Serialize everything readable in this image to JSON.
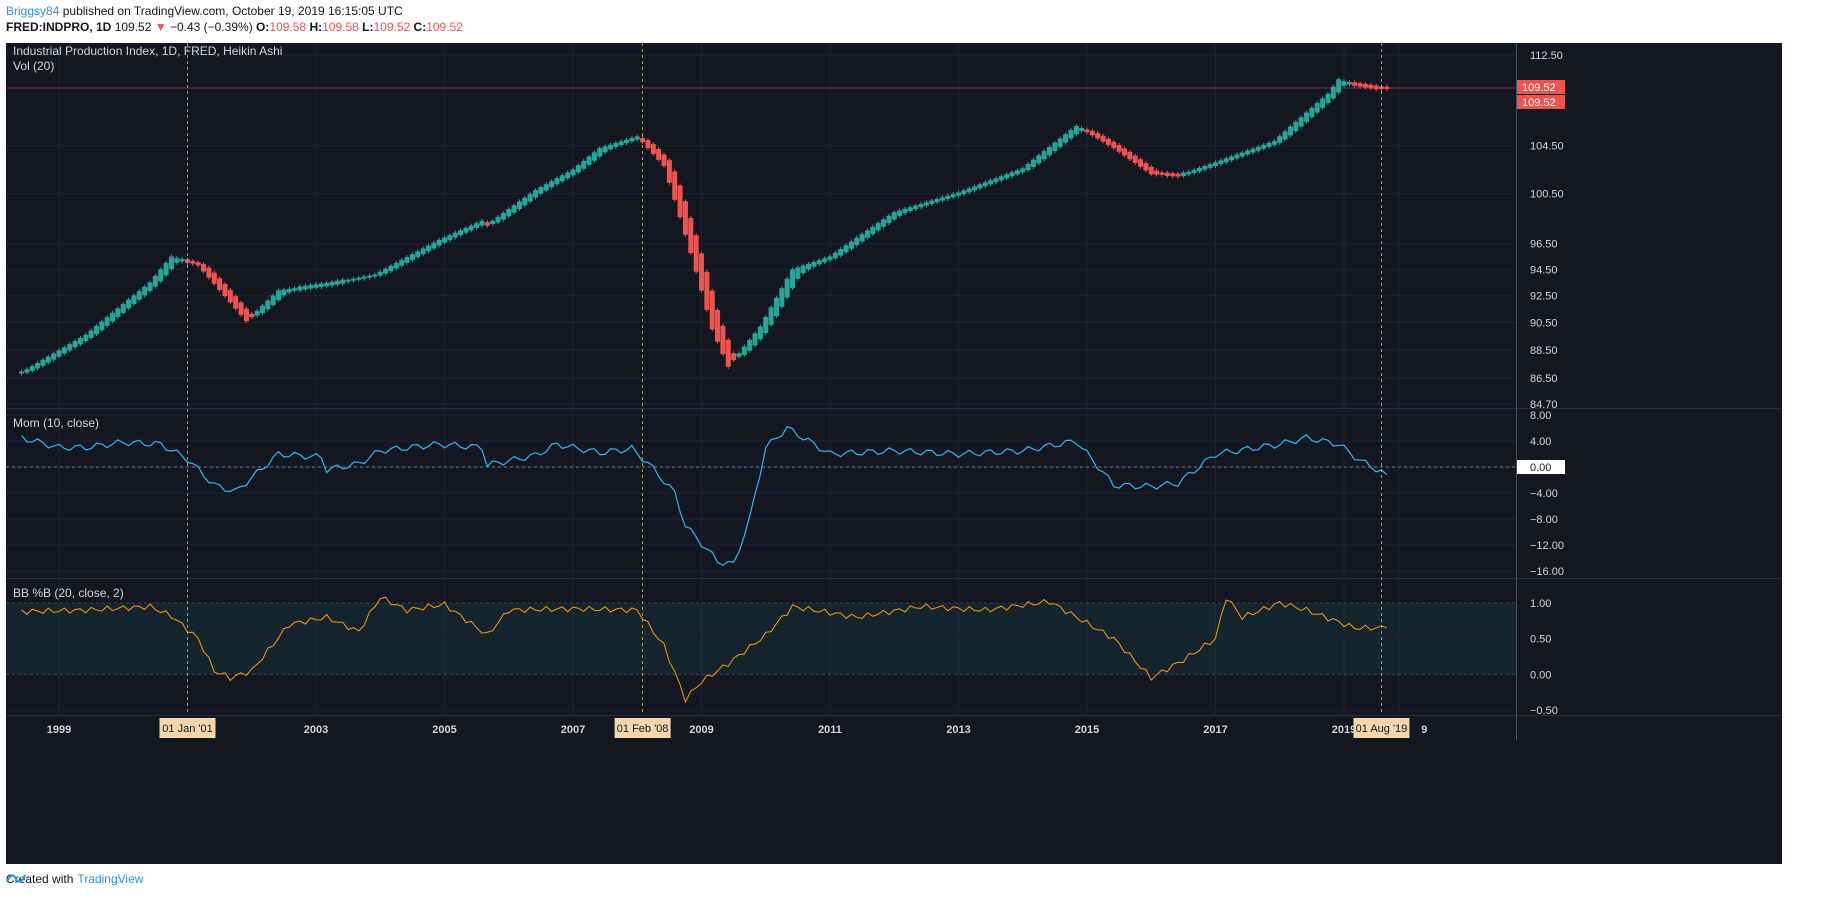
{
  "header": {
    "author": "Briggsy84",
    "published_text": "published on TradingView.com, October 19, 2019 16:15:05 UTC"
  },
  "quote": {
    "symbol": "FRED:INDPRO, 1D",
    "last": "109.52",
    "change_arrow": "▼",
    "change": "−0.43 (−0.39%)",
    "o_label": "O:",
    "o": "109.58",
    "h_label": "H:",
    "h": "109.58",
    "l_label": "L:",
    "l": "109.52",
    "c_label": "C:",
    "c": "109.52"
  },
  "footer": {
    "created_with": "Created with",
    "brand": "TradingView"
  },
  "colors": {
    "bg": "#131722",
    "up": "#26a69a",
    "down": "#ef5350",
    "mom": "#29b6f6",
    "bb": "#ff9800",
    "text": "#d1d4dc"
  },
  "chart_data": [
    {
      "type": "candlestick",
      "title": "Industrial Production Index, 1D, FRED, Heikin Ashi",
      "subtitle": "Vol (20)",
      "y_ticks": [
        "112.50",
        "109.52",
        "104.50",
        "100.50",
        "96.50",
        "94.50",
        "92.50",
        "90.50",
        "88.50",
        "86.50",
        "84.70"
      ],
      "ylim": [
        84.7,
        112.5
      ],
      "last_price_labels": [
        "109.52",
        "109.52"
      ],
      "x_tick_labels": [
        "1999",
        "2003",
        "2005",
        "2007",
        "2009",
        "2011",
        "2013",
        "2015",
        "2017",
        "2019",
        "9"
      ],
      "vertical_markers": [
        "01 Jan '01",
        "01 Feb '08",
        "01 Aug '19"
      ],
      "anchors": [
        [
          "1998-06",
          86.9
        ],
        [
          "1999-06",
          89.6
        ],
        [
          "2000-06",
          93.5
        ],
        [
          "2000-10",
          95.5
        ],
        [
          "2001-03",
          94.8
        ],
        [
          "2001-12",
          90.6
        ],
        [
          "2002-06",
          92.9
        ],
        [
          "2003-03",
          93.4
        ],
        [
          "2003-12",
          94.1
        ],
        [
          "2004-12",
          96.8
        ],
        [
          "2005-08",
          98.3
        ],
        [
          "2005-09",
          98.0
        ],
        [
          "2006-06",
          100.8
        ],
        [
          "2007-01",
          102.5
        ],
        [
          "2007-06",
          104.3
        ],
        [
          "2008-01",
          105.3
        ],
        [
          "2008-06",
          102.8
        ],
        [
          "2008-10",
          97.2
        ],
        [
          "2009-03",
          90.0
        ],
        [
          "2009-06",
          87.3
        ],
        [
          "2009-12",
          90.2
        ],
        [
          "2010-06",
          94.5
        ],
        [
          "2011-01",
          95.5
        ],
        [
          "2012-01",
          99.0
        ],
        [
          "2013-01",
          100.6
        ],
        [
          "2014-01",
          102.6
        ],
        [
          "2014-11",
          106.2
        ],
        [
          "2015-06",
          104.3
        ],
        [
          "2016-01",
          102.1
        ],
        [
          "2016-06",
          102.0
        ],
        [
          "2017-01",
          103.1
        ],
        [
          "2017-12",
          104.9
        ],
        [
          "2018-10",
          109.0
        ],
        [
          "2018-12",
          110.3
        ],
        [
          "2019-03",
          109.8
        ],
        [
          "2019-07",
          109.5
        ],
        [
          "2019-09",
          109.52
        ]
      ]
    },
    {
      "type": "line",
      "title": "Mom (10, close)",
      "y_ticks": [
        "8.00",
        "4.00",
        "0.00",
        "−4.00",
        "−8.00",
        "−12.00",
        "−16.00"
      ],
      "ylim": [
        -16,
        8
      ],
      "points": [
        [
          "1998-06",
          4.5
        ],
        [
          "1999-01",
          3.0
        ],
        [
          "1999-06",
          3.0
        ],
        [
          "2000-01",
          3.8
        ],
        [
          "2000-08",
          3.5
        ],
        [
          "2001-01",
          1.2
        ],
        [
          "2001-06",
          -2.8
        ],
        [
          "2001-10",
          -3.8
        ],
        [
          "2002-06",
          2.0
        ],
        [
          "2003-02",
          1.5
        ],
        [
          "2003-03",
          -0.4
        ],
        [
          "2003-09",
          0.5
        ],
        [
          "2004-01",
          2.5
        ],
        [
          "2004-12",
          3.5
        ],
        [
          "2005-08",
          3.0
        ],
        [
          "2005-09",
          0.3
        ],
        [
          "2006-06",
          1.8
        ],
        [
          "2006-10",
          3.5
        ],
        [
          "2007-06",
          2.2
        ],
        [
          "2007-12",
          2.8
        ],
        [
          "2008-03",
          0.6
        ],
        [
          "2008-08",
          -4.0
        ],
        [
          "2008-10",
          -9.0
        ],
        [
          "2009-04",
          -14.5
        ],
        [
          "2009-07",
          -15.0
        ],
        [
          "2009-10",
          -8.0
        ],
        [
          "2010-01",
          3.0
        ],
        [
          "2010-05",
          6.0
        ],
        [
          "2011-01",
          2.0
        ],
        [
          "2012-01",
          2.5
        ],
        [
          "2013-01",
          2.0
        ],
        [
          "2014-01",
          2.5
        ],
        [
          "2014-11",
          4.0
        ],
        [
          "2015-06",
          -2.8
        ],
        [
          "2016-01",
          -3.0
        ],
        [
          "2016-06",
          -2.5
        ],
        [
          "2017-01",
          2.0
        ],
        [
          "2018-01",
          3.5
        ],
        [
          "2018-06",
          4.5
        ],
        [
          "2018-12",
          3.5
        ],
        [
          "2019-04",
          1.0
        ],
        [
          "2019-09",
          -1.2
        ]
      ]
    },
    {
      "type": "line",
      "title": "BB %B (20, close, 2)",
      "y_ticks": [
        "1.00",
        "0.50",
        "0.00",
        "−0.50"
      ],
      "ylim": [
        -0.5,
        1.0
      ],
      "band": [
        0,
        1
      ],
      "points": [
        [
          "1998-06",
          0.88
        ],
        [
          "1999-06",
          0.9
        ],
        [
          "2000-06",
          0.95
        ],
        [
          "2000-10",
          0.82
        ],
        [
          "2001-03",
          0.5
        ],
        [
          "2001-06",
          0.05
        ],
        [
          "2001-09",
          -0.05
        ],
        [
          "2002-01",
          0.05
        ],
        [
          "2002-08",
          0.7
        ],
        [
          "2003-03",
          0.8
        ],
        [
          "2003-09",
          0.6
        ],
        [
          "2004-01",
          1.08
        ],
        [
          "2004-06",
          0.9
        ],
        [
          "2005-01",
          0.98
        ],
        [
          "2005-09",
          0.55
        ],
        [
          "2006-01",
          0.9
        ],
        [
          "2007-01",
          0.92
        ],
        [
          "2008-01",
          0.9
        ],
        [
          "2008-06",
          0.4
        ],
        [
          "2008-10",
          -0.35
        ],
        [
          "2009-01",
          -0.1
        ],
        [
          "2009-06",
          0.15
        ],
        [
          "2010-01",
          0.55
        ],
        [
          "2010-06",
          0.95
        ],
        [
          "2011-06",
          0.8
        ],
        [
          "2012-06",
          0.95
        ],
        [
          "2013-06",
          0.9
        ],
        [
          "2014-06",
          1.02
        ],
        [
          "2015-06",
          0.5
        ],
        [
          "2016-01",
          -0.05
        ],
        [
          "2016-07",
          0.2
        ],
        [
          "2017-01",
          0.5
        ],
        [
          "2017-03",
          1.08
        ],
        [
          "2017-06",
          0.8
        ],
        [
          "2018-01",
          1.0
        ],
        [
          "2018-06",
          0.9
        ],
        [
          "2019-03",
          0.65
        ],
        [
          "2019-09",
          0.65
        ]
      ]
    }
  ]
}
